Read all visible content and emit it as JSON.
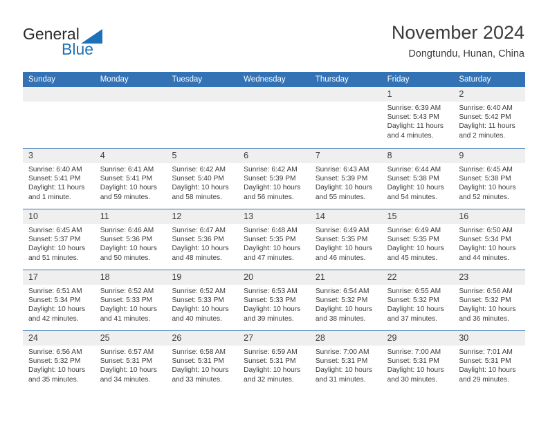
{
  "logo": {
    "word_one": "General",
    "word_two": "Blue",
    "triangle_color": "#1d71b8"
  },
  "header": {
    "title": "November 2024",
    "subtitle": "Dongtundu, Hunan, China",
    "accent_color": "#3272b5",
    "datestrip_color": "#efefef"
  },
  "weekdays": [
    "Sunday",
    "Monday",
    "Tuesday",
    "Wednesday",
    "Thursday",
    "Friday",
    "Saturday"
  ],
  "weeks": [
    [
      {
        "day": "",
        "sunrise": "",
        "sunset": "",
        "daylight": "",
        "empty": true
      },
      {
        "day": "",
        "sunrise": "",
        "sunset": "",
        "daylight": "",
        "empty": true
      },
      {
        "day": "",
        "sunrise": "",
        "sunset": "",
        "daylight": "",
        "empty": true
      },
      {
        "day": "",
        "sunrise": "",
        "sunset": "",
        "daylight": "",
        "empty": true
      },
      {
        "day": "",
        "sunrise": "",
        "sunset": "",
        "daylight": "",
        "empty": true
      },
      {
        "day": "1",
        "sunrise": "Sunrise: 6:39 AM",
        "sunset": "Sunset: 5:43 PM",
        "daylight": "Daylight: 11 hours and 4 minutes.",
        "empty": false
      },
      {
        "day": "2",
        "sunrise": "Sunrise: 6:40 AM",
        "sunset": "Sunset: 5:42 PM",
        "daylight": "Daylight: 11 hours and 2 minutes.",
        "empty": false
      }
    ],
    [
      {
        "day": "3",
        "sunrise": "Sunrise: 6:40 AM",
        "sunset": "Sunset: 5:41 PM",
        "daylight": "Daylight: 11 hours and 1 minute.",
        "empty": false
      },
      {
        "day": "4",
        "sunrise": "Sunrise: 6:41 AM",
        "sunset": "Sunset: 5:41 PM",
        "daylight": "Daylight: 10 hours and 59 minutes.",
        "empty": false
      },
      {
        "day": "5",
        "sunrise": "Sunrise: 6:42 AM",
        "sunset": "Sunset: 5:40 PM",
        "daylight": "Daylight: 10 hours and 58 minutes.",
        "empty": false
      },
      {
        "day": "6",
        "sunrise": "Sunrise: 6:42 AM",
        "sunset": "Sunset: 5:39 PM",
        "daylight": "Daylight: 10 hours and 56 minutes.",
        "empty": false
      },
      {
        "day": "7",
        "sunrise": "Sunrise: 6:43 AM",
        "sunset": "Sunset: 5:39 PM",
        "daylight": "Daylight: 10 hours and 55 minutes.",
        "empty": false
      },
      {
        "day": "8",
        "sunrise": "Sunrise: 6:44 AM",
        "sunset": "Sunset: 5:38 PM",
        "daylight": "Daylight: 10 hours and 54 minutes.",
        "empty": false
      },
      {
        "day": "9",
        "sunrise": "Sunrise: 6:45 AM",
        "sunset": "Sunset: 5:38 PM",
        "daylight": "Daylight: 10 hours and 52 minutes.",
        "empty": false
      }
    ],
    [
      {
        "day": "10",
        "sunrise": "Sunrise: 6:45 AM",
        "sunset": "Sunset: 5:37 PM",
        "daylight": "Daylight: 10 hours and 51 minutes.",
        "empty": false
      },
      {
        "day": "11",
        "sunrise": "Sunrise: 6:46 AM",
        "sunset": "Sunset: 5:36 PM",
        "daylight": "Daylight: 10 hours and 50 minutes.",
        "empty": false
      },
      {
        "day": "12",
        "sunrise": "Sunrise: 6:47 AM",
        "sunset": "Sunset: 5:36 PM",
        "daylight": "Daylight: 10 hours and 48 minutes.",
        "empty": false
      },
      {
        "day": "13",
        "sunrise": "Sunrise: 6:48 AM",
        "sunset": "Sunset: 5:35 PM",
        "daylight": "Daylight: 10 hours and 47 minutes.",
        "empty": false
      },
      {
        "day": "14",
        "sunrise": "Sunrise: 6:49 AM",
        "sunset": "Sunset: 5:35 PM",
        "daylight": "Daylight: 10 hours and 46 minutes.",
        "empty": false
      },
      {
        "day": "15",
        "sunrise": "Sunrise: 6:49 AM",
        "sunset": "Sunset: 5:35 PM",
        "daylight": "Daylight: 10 hours and 45 minutes.",
        "empty": false
      },
      {
        "day": "16",
        "sunrise": "Sunrise: 6:50 AM",
        "sunset": "Sunset: 5:34 PM",
        "daylight": "Daylight: 10 hours and 44 minutes.",
        "empty": false
      }
    ],
    [
      {
        "day": "17",
        "sunrise": "Sunrise: 6:51 AM",
        "sunset": "Sunset: 5:34 PM",
        "daylight": "Daylight: 10 hours and 42 minutes.",
        "empty": false
      },
      {
        "day": "18",
        "sunrise": "Sunrise: 6:52 AM",
        "sunset": "Sunset: 5:33 PM",
        "daylight": "Daylight: 10 hours and 41 minutes.",
        "empty": false
      },
      {
        "day": "19",
        "sunrise": "Sunrise: 6:52 AM",
        "sunset": "Sunset: 5:33 PM",
        "daylight": "Daylight: 10 hours and 40 minutes.",
        "empty": false
      },
      {
        "day": "20",
        "sunrise": "Sunrise: 6:53 AM",
        "sunset": "Sunset: 5:33 PM",
        "daylight": "Daylight: 10 hours and 39 minutes.",
        "empty": false
      },
      {
        "day": "21",
        "sunrise": "Sunrise: 6:54 AM",
        "sunset": "Sunset: 5:32 PM",
        "daylight": "Daylight: 10 hours and 38 minutes.",
        "empty": false
      },
      {
        "day": "22",
        "sunrise": "Sunrise: 6:55 AM",
        "sunset": "Sunset: 5:32 PM",
        "daylight": "Daylight: 10 hours and 37 minutes.",
        "empty": false
      },
      {
        "day": "23",
        "sunrise": "Sunrise: 6:56 AM",
        "sunset": "Sunset: 5:32 PM",
        "daylight": "Daylight: 10 hours and 36 minutes.",
        "empty": false
      }
    ],
    [
      {
        "day": "24",
        "sunrise": "Sunrise: 6:56 AM",
        "sunset": "Sunset: 5:32 PM",
        "daylight": "Daylight: 10 hours and 35 minutes.",
        "empty": false
      },
      {
        "day": "25",
        "sunrise": "Sunrise: 6:57 AM",
        "sunset": "Sunset: 5:31 PM",
        "daylight": "Daylight: 10 hours and 34 minutes.",
        "empty": false
      },
      {
        "day": "26",
        "sunrise": "Sunrise: 6:58 AM",
        "sunset": "Sunset: 5:31 PM",
        "daylight": "Daylight: 10 hours and 33 minutes.",
        "empty": false
      },
      {
        "day": "27",
        "sunrise": "Sunrise: 6:59 AM",
        "sunset": "Sunset: 5:31 PM",
        "daylight": "Daylight: 10 hours and 32 minutes.",
        "empty": false
      },
      {
        "day": "28",
        "sunrise": "Sunrise: 7:00 AM",
        "sunset": "Sunset: 5:31 PM",
        "daylight": "Daylight: 10 hours and 31 minutes.",
        "empty": false
      },
      {
        "day": "29",
        "sunrise": "Sunrise: 7:00 AM",
        "sunset": "Sunset: 5:31 PM",
        "daylight": "Daylight: 10 hours and 30 minutes.",
        "empty": false
      },
      {
        "day": "30",
        "sunrise": "Sunrise: 7:01 AM",
        "sunset": "Sunset: 5:31 PM",
        "daylight": "Daylight: 10 hours and 29 minutes.",
        "empty": false
      }
    ]
  ]
}
